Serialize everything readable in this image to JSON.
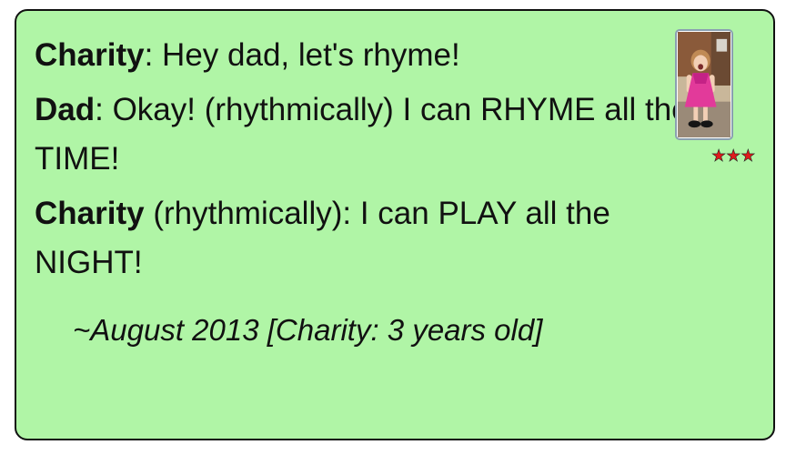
{
  "quote": {
    "lines": [
      {
        "speaker": "Charity",
        "text": ": Hey dad, let's rhyme!"
      },
      {
        "speaker": "Dad",
        "text": ": Okay! (rhythmically) I can RHYME all the TIME!"
      },
      {
        "speaker": "Charity",
        "text": " (rhythmically): I can PLAY all the NIGHT!"
      }
    ],
    "attribution": "~August 2013 [Charity: 3 years old]"
  },
  "thumbnail": {
    "icon": "child-photo"
  },
  "rating": {
    "stars_text": "★★★",
    "value": 3,
    "color": "#e01b1b"
  },
  "colors": {
    "card_background": "#b0f5a6",
    "border": "#111111"
  }
}
